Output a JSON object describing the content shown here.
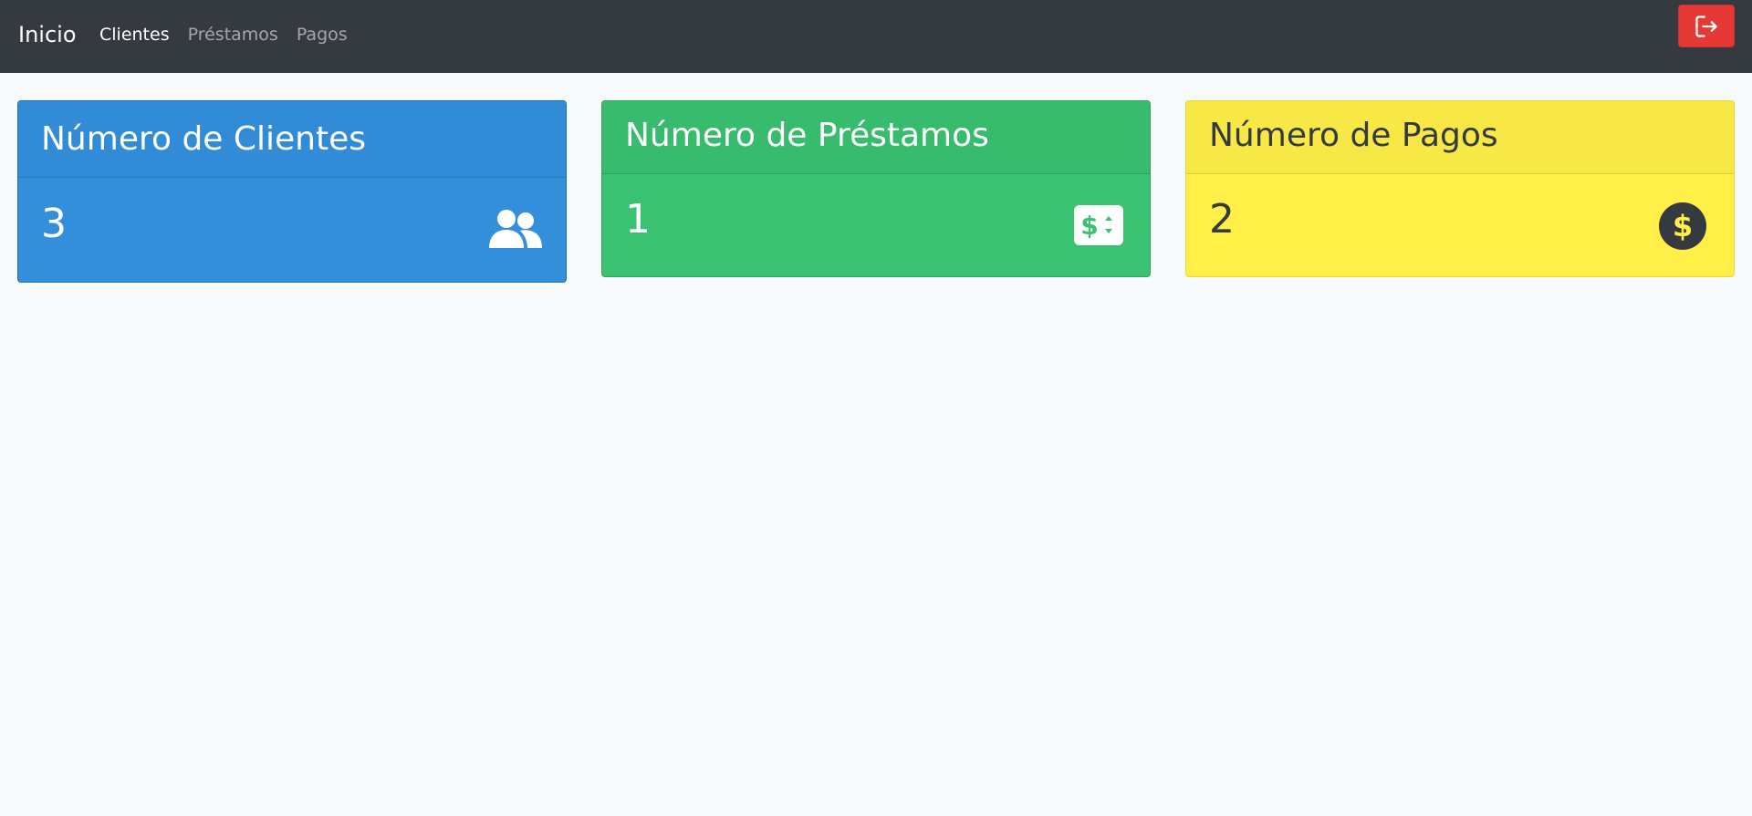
{
  "navbar": {
    "brand": "Inicio",
    "links": [
      {
        "label": "Clientes",
        "active": true
      },
      {
        "label": "Préstamos",
        "active": false
      },
      {
        "label": "Pagos",
        "active": false
      }
    ],
    "logout_icon": "logout-icon",
    "logout_color": "#e53935"
  },
  "cards": {
    "clientes": {
      "title": "Número de Clientes",
      "value": "3",
      "icon": "users-icon",
      "color": "#348fdb"
    },
    "prestamos": {
      "title": "Número de Préstamos",
      "value": "1",
      "icon": "money-bill-icon",
      "color": "#3bc172"
    },
    "pagos": {
      "title": "Número de Pagos",
      "value": "2",
      "icon": "dollar-circle-icon",
      "color": "#ffef47"
    }
  }
}
